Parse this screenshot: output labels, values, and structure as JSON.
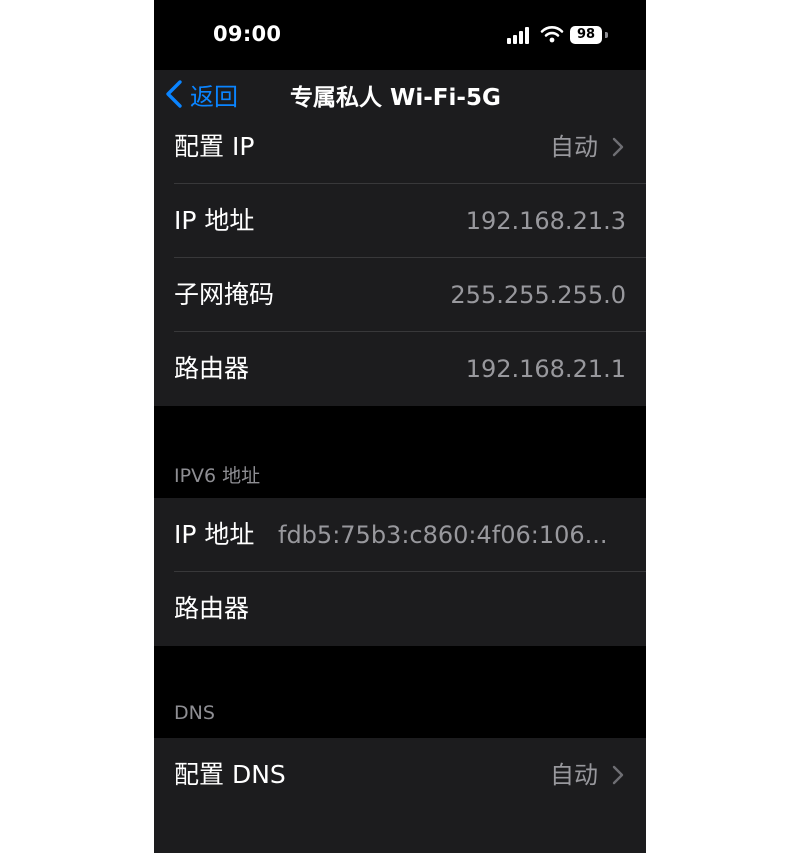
{
  "status_bar": {
    "time": "09:00",
    "battery": "98",
    "icons": [
      "signal-icon",
      "wifi-icon",
      "battery-icon"
    ]
  },
  "nav": {
    "back_label": "返回",
    "title": "专属私人 Wi-Fi-5G",
    "accent_color": "#0a84ff"
  },
  "ipv4": {
    "rows": [
      {
        "label": "配置 IP",
        "value": "自动"
      },
      {
        "label": "IP 地址",
        "value": "192.168.21.3"
      },
      {
        "label": "子网掩码",
        "value": "255.255.255.0"
      },
      {
        "label": "路由器",
        "value": "192.168.21.1"
      }
    ]
  },
  "ipv6": {
    "header": "IPV6 地址",
    "rows": [
      {
        "label": "IP 地址",
        "value": "fdb5:75b3:c860:4f06:106..."
      },
      {
        "label": "路由器",
        "value": ""
      }
    ]
  },
  "dns": {
    "header": "DNS",
    "rows": [
      {
        "label": "配置 DNS",
        "value": "自动"
      }
    ]
  }
}
